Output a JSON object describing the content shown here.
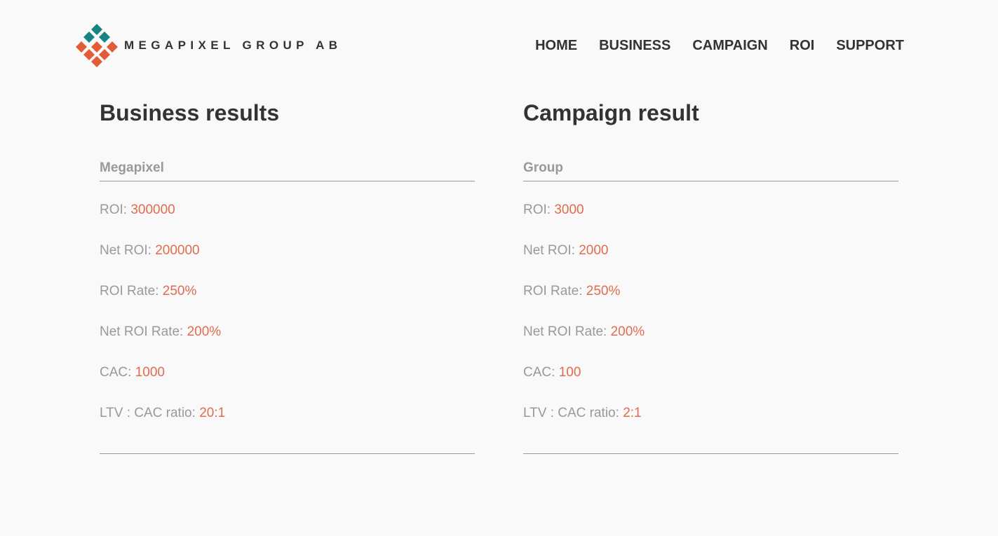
{
  "brand": {
    "name": "MEGAPIXEL GROUP AB",
    "colors": {
      "teal": "#158482",
      "orange": "#e25d35",
      "value": "#e06c4f"
    }
  },
  "nav": {
    "items": [
      "HOME",
      "BUSINESS",
      "CAMPAIGN",
      "ROI",
      "SUPPORT"
    ]
  },
  "business": {
    "title": "Business results",
    "subtitle": "Megapixel",
    "metrics": [
      {
        "label": "ROI: ",
        "value": "300000"
      },
      {
        "label": "Net ROI: ",
        "value": "200000"
      },
      {
        "label": "ROI Rate: ",
        "value": "250%"
      },
      {
        "label": "Net ROI Rate: ",
        "value": "200%"
      },
      {
        "label": "CAC: ",
        "value": "1000"
      },
      {
        "label": "LTV : CAC ratio: ",
        "value": "20:1"
      }
    ]
  },
  "campaign": {
    "title": "Campaign result",
    "subtitle": "Group",
    "metrics": [
      {
        "label": "ROI: ",
        "value": "3000"
      },
      {
        "label": "Net ROI: ",
        "value": "2000"
      },
      {
        "label": "ROI Rate: ",
        "value": "250%"
      },
      {
        "label": "Net ROI Rate: ",
        "value": "200%"
      },
      {
        "label": "CAC: ",
        "value": "100"
      },
      {
        "label": "LTV : CAC ratio: ",
        "value": "2:1"
      }
    ]
  }
}
